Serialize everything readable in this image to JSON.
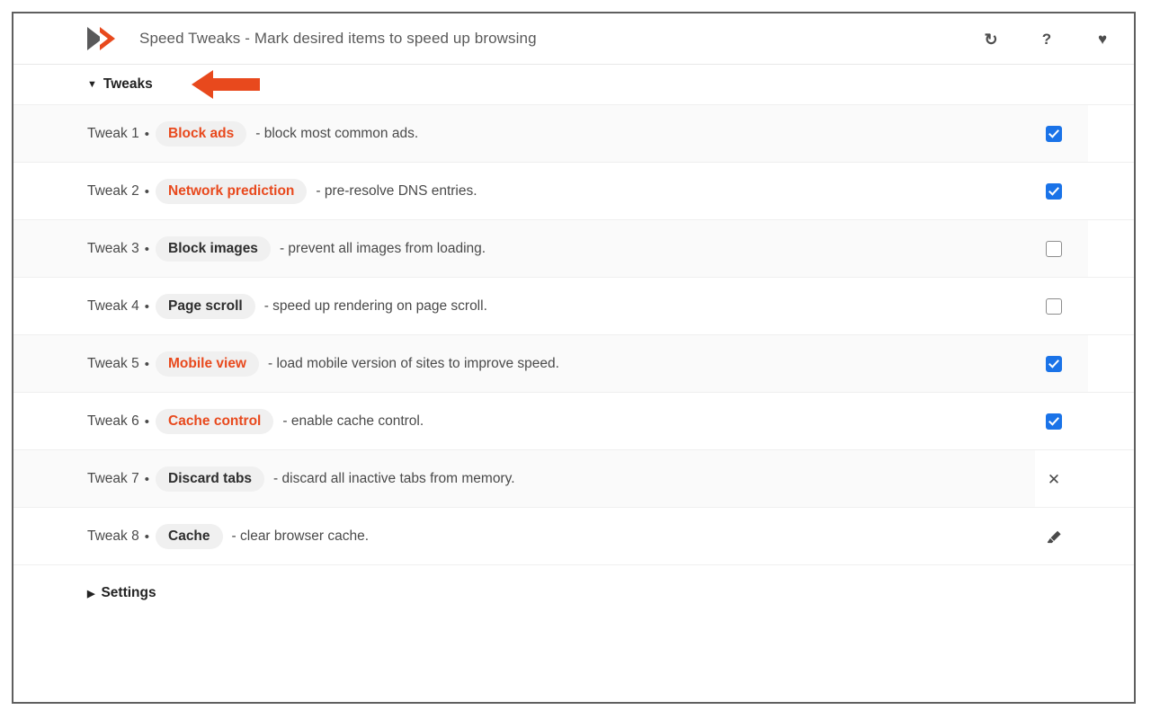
{
  "window": {
    "border_color": "#5f5f5f"
  },
  "header": {
    "logo_icon": "double-chevron-logo",
    "title": "Speed Tweaks - Mark desired items to speed up browsing",
    "actions": [
      {
        "icon": "refresh-icon",
        "glyph": "↻"
      },
      {
        "icon": "help-icon",
        "glyph": "?"
      },
      {
        "icon": "favorite-heart-icon",
        "glyph": "♥"
      }
    ]
  },
  "sections": {
    "tweaks": {
      "label": "Tweaks",
      "caret": "▼",
      "expanded": true,
      "annotation": "left-pointing-orange-arrow"
    },
    "settings": {
      "label": "Settings",
      "caret": "▶",
      "expanded": false
    }
  },
  "colors": {
    "accent_orange": "#e8491d",
    "checkbox_blue": "#1a73e8",
    "pill_background": "#f0f0f0",
    "row_background": "#fafafa",
    "text": "#4a4a4a"
  },
  "dot_separator": "•",
  "rows": [
    {
      "index_label": "Tweak 1",
      "pill_label": "Block ads",
      "pill_style": "accent",
      "description": "- block most common ads.",
      "control": "checkbox",
      "checked": true
    },
    {
      "index_label": "Tweak 2",
      "pill_label": "Network prediction",
      "pill_style": "accent",
      "description": "- pre-resolve DNS entries.",
      "control": "checkbox",
      "checked": true
    },
    {
      "index_label": "Tweak 3",
      "pill_label": "Block images",
      "pill_style": "neutral",
      "description": "- prevent all images from loading.",
      "control": "checkbox",
      "checked": false
    },
    {
      "index_label": "Tweak 4",
      "pill_label": "Page scroll",
      "pill_style": "neutral",
      "description": "- speed up rendering on page scroll.",
      "control": "checkbox",
      "checked": false
    },
    {
      "index_label": "Tweak 5",
      "pill_label": "Mobile view",
      "pill_style": "accent",
      "description": "- load mobile version of sites to improve speed.",
      "control": "checkbox",
      "checked": true
    },
    {
      "index_label": "Tweak 6",
      "pill_label": "Cache control",
      "pill_style": "accent",
      "description": "- enable cache control.",
      "control": "checkbox",
      "checked": true
    },
    {
      "index_label": "Tweak 7",
      "pill_label": "Discard tabs",
      "pill_style": "neutral",
      "description": "- discard all inactive tabs from memory.",
      "control": "close-x-icon",
      "glyph": "✕"
    },
    {
      "index_label": "Tweak 8",
      "pill_label": "Cache",
      "pill_style": "neutral",
      "description": "- clear browser cache.",
      "control": "eraser-icon",
      "glyph": ""
    }
  ]
}
